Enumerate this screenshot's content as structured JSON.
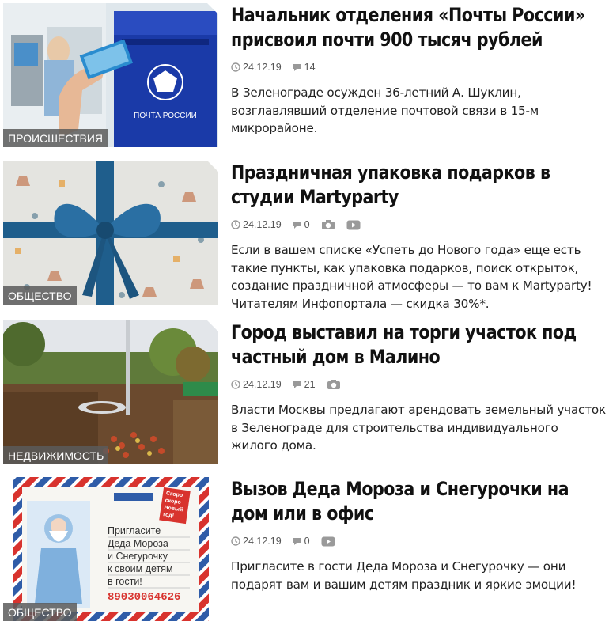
{
  "news": [
    {
      "category": "ПРОИСШЕСТВИЯ",
      "title": "Начальник отделения «Почты России» присвоил почти 900 тысяч рублей",
      "date": "24.12.19",
      "comments": "14",
      "has_photo": false,
      "has_video": false,
      "lead": "В Зеленограде осужден 36-летний А. Шуклин, возглавлявший отделение почтовой связи в 15-м микрорайоне.",
      "image": {
        "label": "ПОЧТА РОССИИ",
        "theme": "post"
      }
    },
    {
      "category": "ОБЩЕСТВО",
      "title": "Праздничная упаковка подарков в студии Martyparty",
      "date": "24.12.19",
      "comments": "0",
      "has_photo": true,
      "has_video": true,
      "lead": "Если в вашем списке «Успеть до Нового года» еще есть такие пункты, как упаковка подарков, поиск открыток, создание праздничной атмосферы — то вам к Martyparty! Читателям Инфопортала — скидка 30%*.",
      "image": {
        "theme": "gift"
      }
    },
    {
      "category": "НЕДВИЖИМОСТЬ",
      "title": "Город выставил на торги участок под частный дом в Малино",
      "date": "24.12.19",
      "comments": "21",
      "has_photo": true,
      "has_video": false,
      "lead": "Власти Москвы предлагают арендовать земельный участок в Зеленограде для строительства индивидуального жилого дома.",
      "image": {
        "theme": "land"
      }
    },
    {
      "category": "ОБЩЕСТВО",
      "title": "Вызов Деда Мороза и Снегурочки на дом или в офис",
      "date": "24.12.19",
      "comments": "0",
      "has_photo": false,
      "has_video": true,
      "lead": "Пригласите в гости Деда Мороза и Снегурочку — они подарят вам и вашим детям праздник и яркие эмоции!",
      "image": {
        "theme": "postcard",
        "postcard_lines": [
          "Пригласите",
          "Деда Мороза",
          "и Снегурочку",
          "к своим детям",
          "в гости!"
        ],
        "phone": "89030064626",
        "stamp": [
          "Скоро",
          "скоро",
          "Новый",
          "год!"
        ]
      }
    }
  ],
  "colors": {
    "post_blue": "#1a3aa8",
    "ribbon_blue": "#1f5e8c",
    "tag_bg": "#5a5a5a",
    "postcard_red": "#d8332e",
    "postcard_blue": "#2f5ca8"
  },
  "icons": [
    "clock-icon",
    "comment-icon",
    "camera-icon",
    "video-icon"
  ]
}
